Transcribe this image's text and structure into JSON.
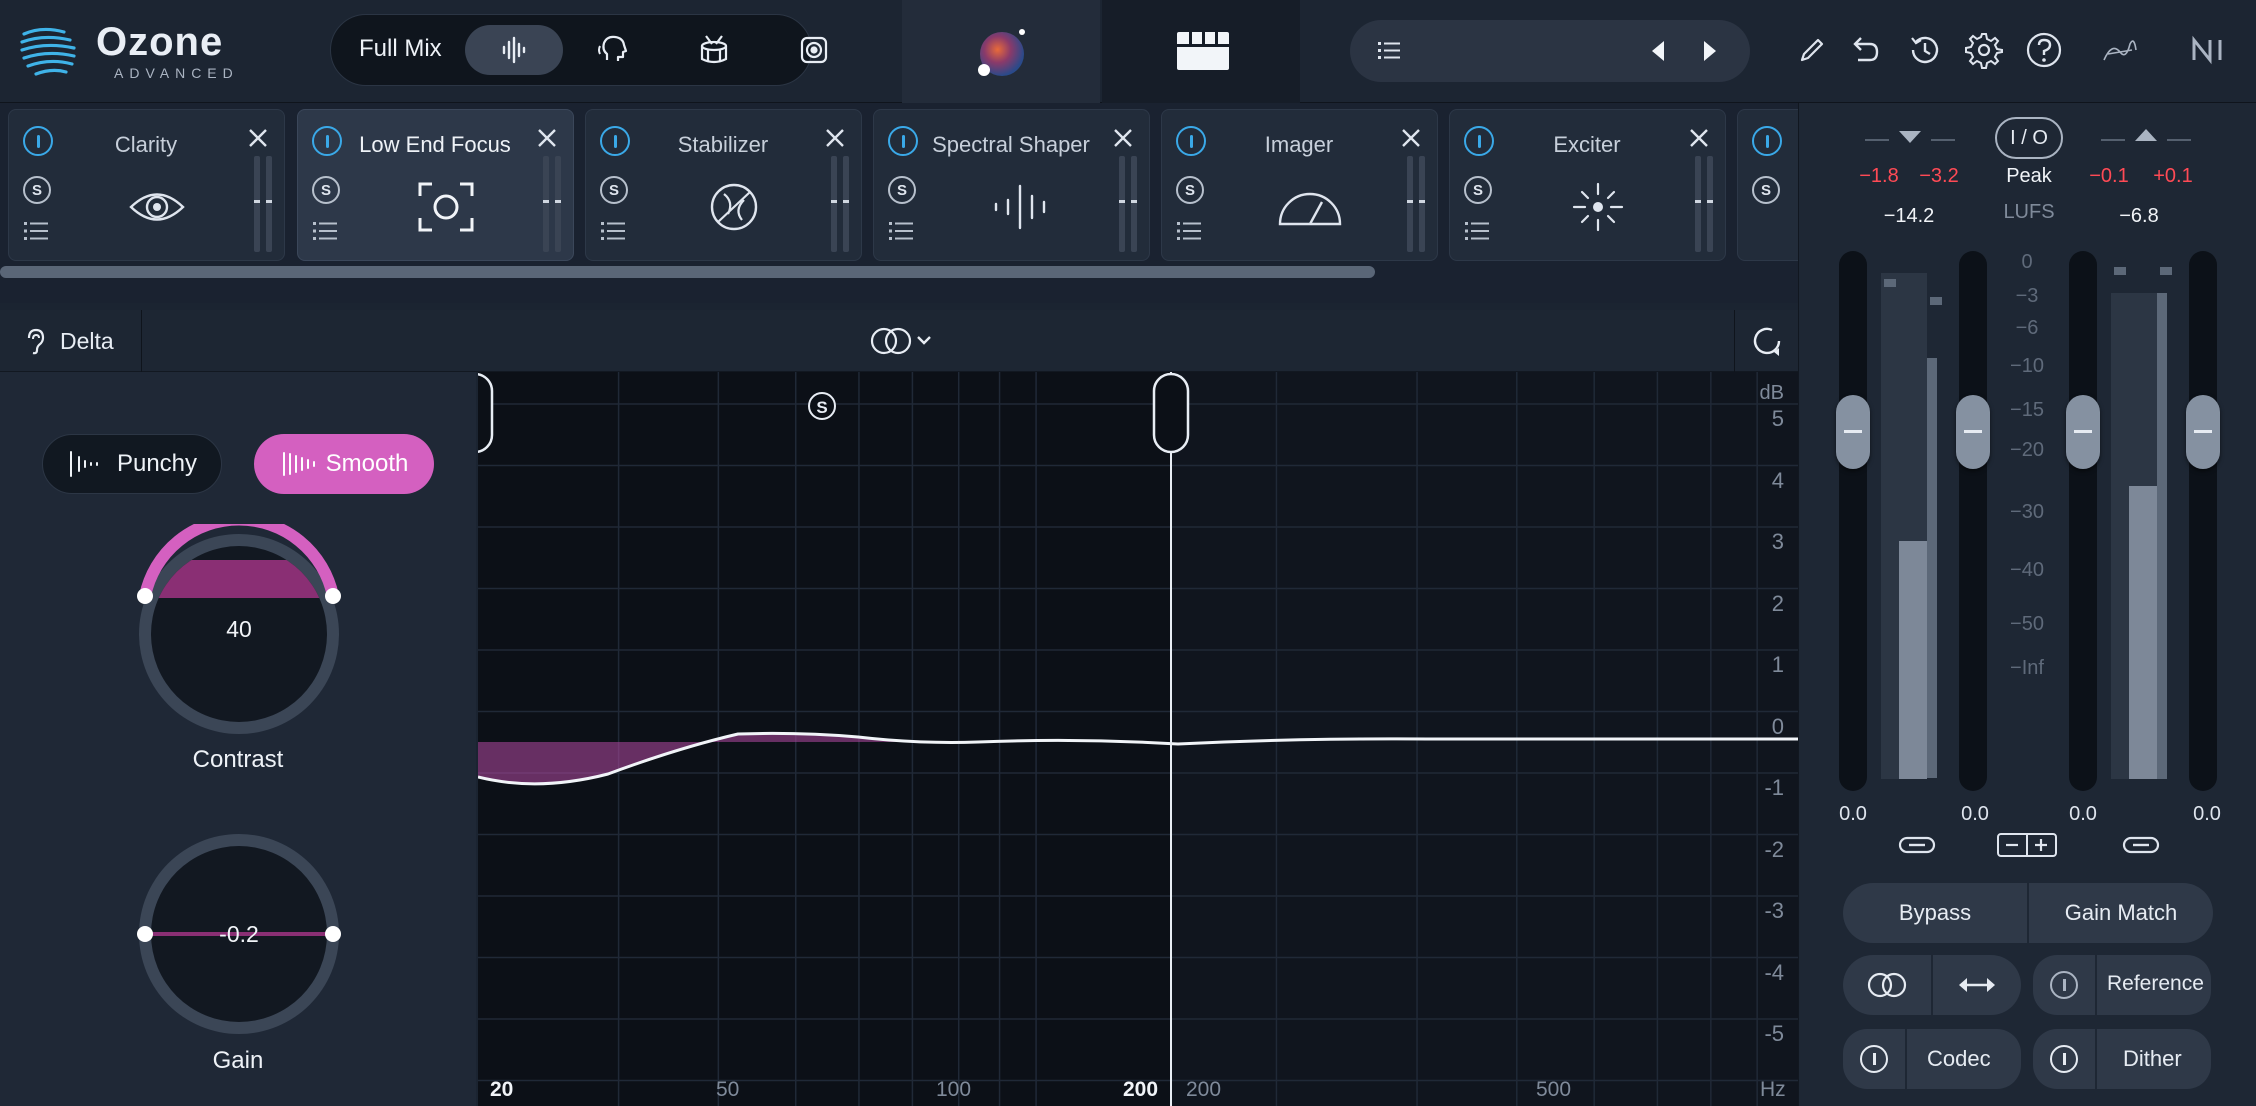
{
  "app": {
    "name": "Ozone",
    "edition": "ADVANCED"
  },
  "top_bar": {
    "mode_label": "Full Mix",
    "mode_buttons": [
      "waveform-icon",
      "vocal-head-icon",
      "drum-icon",
      "speaker-icon"
    ],
    "active_mode": 0
  },
  "modules": [
    {
      "name": "Clarity",
      "icon": "eye-icon",
      "active": false
    },
    {
      "name": "Low End Focus",
      "icon": "focus-icon",
      "active": true
    },
    {
      "name": "Stabilizer",
      "icon": "stabilizer-icon",
      "active": false
    },
    {
      "name": "Spectral Shaper",
      "icon": "spectral-icon",
      "active": false
    },
    {
      "name": "Imager",
      "icon": "imager-icon",
      "active": false
    },
    {
      "name": "Exciter",
      "icon": "exciter-icon",
      "active": false
    }
  ],
  "delta": {
    "label": "Delta"
  },
  "left_panel": {
    "punchy_label": "Punchy",
    "smooth_label": "Smooth",
    "selected_mode": "Smooth",
    "contrast": {
      "label": "Contrast",
      "value": "40"
    },
    "gain": {
      "label": "Gain",
      "value": "-0.2"
    }
  },
  "graph": {
    "y_unit": "dB",
    "y_labels": [
      "5",
      "4",
      "3",
      "2",
      "1",
      "0",
      "-1",
      "-2",
      "-3",
      "-4",
      "-5"
    ],
    "x_labels": [
      {
        "text": "20",
        "bold": true
      },
      {
        "text": "50",
        "bold": false
      },
      {
        "text": "100",
        "bold": false
      },
      {
        "text": "200",
        "bold": true
      },
      {
        "text": "200",
        "bold": false
      },
      {
        "text": "500",
        "bold": false
      },
      {
        "text": "Hz",
        "bold": false
      }
    ],
    "solo_marker": "S"
  },
  "meters": {
    "input_peaks": [
      "−1.8",
      "−3.2"
    ],
    "output_peaks": [
      "−0.1",
      "+0.1"
    ],
    "io_label": "I / O",
    "peak_label": "Peak",
    "lufs_label": "LUFS",
    "input_lufs": "−14.2",
    "output_lufs": "−6.8",
    "scale": [
      "0",
      "−3",
      "−6",
      "−10",
      "−15",
      "−20",
      "−30",
      "−40",
      "−50",
      "−Inf"
    ],
    "fader_values": [
      "0.0",
      "0.0",
      "0.0",
      "0.0"
    ],
    "input_level": 0.47,
    "output_level": 0.58
  },
  "bottom_buttons": {
    "bypass": "Bypass",
    "gain_match": "Gain Match",
    "reference": "Reference",
    "codec": "Codec",
    "dither": "Dither"
  },
  "colors": {
    "accent_pink": "#d460c0",
    "power_blue": "#3aa9e8",
    "peak_red": "#ff4a55"
  }
}
